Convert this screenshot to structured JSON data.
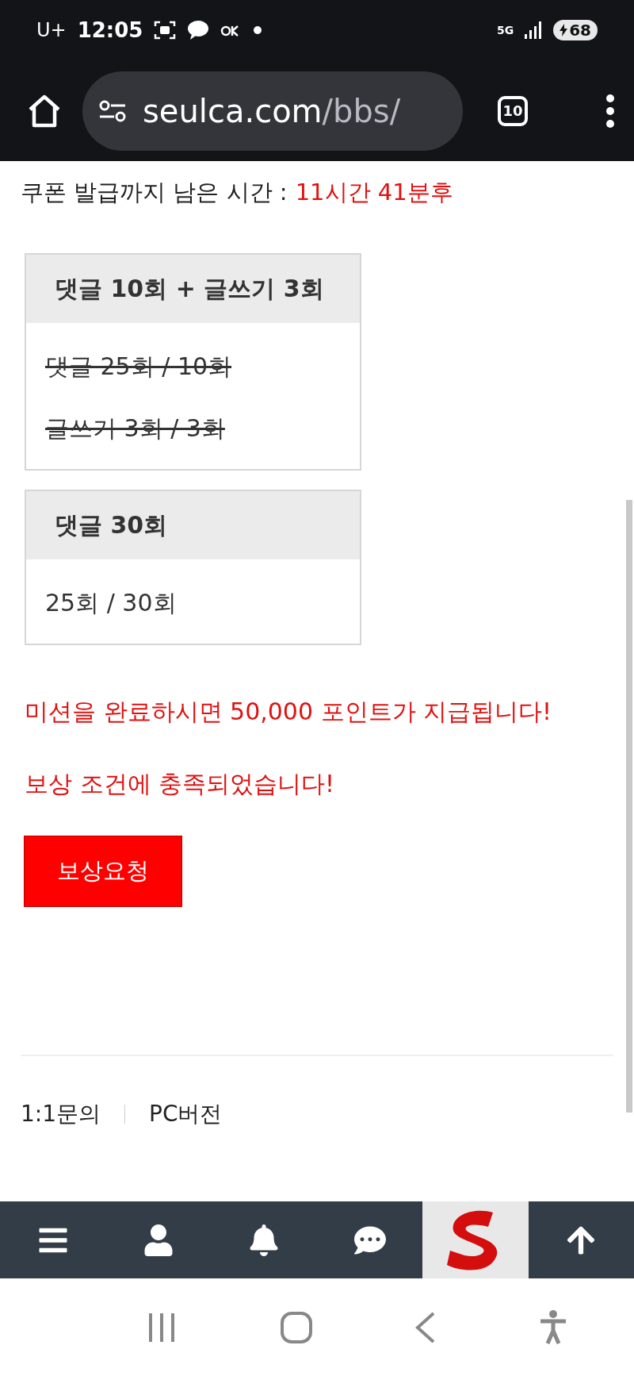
{
  "status_bar": {
    "carrier": "U+",
    "time": "12:05",
    "network": "5G",
    "battery": "68"
  },
  "browser": {
    "url_host": "seulca.com",
    "url_path": "/bbs/",
    "tab_count": "10"
  },
  "coupon": {
    "label": "쿠폰 발급까지 남은 시간 :",
    "remaining": "11시간 41분후"
  },
  "missions": [
    {
      "title": "댓글 10회 + 글쓰기 3회",
      "items": [
        {
          "text": "댓글 25회 / 10회",
          "done": true
        },
        {
          "text": "글쓰기 3회 / 3회",
          "done": true
        }
      ]
    },
    {
      "title": "댓글 30회",
      "items": [
        {
          "text": "25회 / 30회",
          "done": false
        }
      ]
    }
  ],
  "messages": [
    "미션을 완료하시면 50,000 포인트가 지급됩니다!",
    "보상 조건에 충족되었습니다!"
  ],
  "reward_button": "보상요청",
  "footer_links": [
    "1:1문의",
    "PC버전"
  ]
}
